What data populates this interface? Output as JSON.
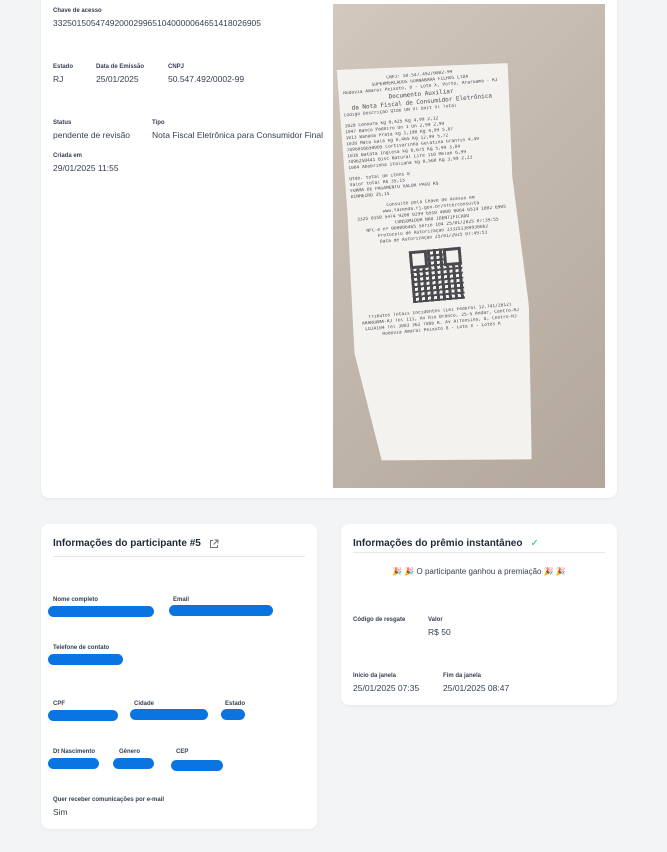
{
  "nota": {
    "chave_label": "Chave de acesso",
    "chave_value": "33250150547492000299651040000064651418026905",
    "estado_label": "Estado",
    "estado_value": "RJ",
    "data_emissao_label": "Data de Emissão",
    "data_emissao_value": "25/01/2025",
    "cnpj_label": "CNPJ",
    "cnpj_value": "50.547.492/0002-99",
    "status_label": "Status",
    "status_value": "pendente de revisão",
    "tipo_label": "Tipo",
    "tipo_value": "Nota Fiscal Eletrônica para Consumidor Final",
    "criada_label": "Criada em",
    "criada_value": "29/01/2025 11:55"
  },
  "receipt": {
    "lines": [
      "CNPJ: 50.547.492/0002-99",
      "SUPERMERCADOS GUANABARA FILHOS LTDA",
      "Rodovia Amaral Peixoto, 8 - Lote X, Porto, Araruama - RJ",
      "Documento Auxiliar",
      "da Nota Fiscal de Consumidor Eletrônica",
      "Código  Descrição   Qtde UN  Vl Unit  Vl Total",
      "1020    Cenoura kg        0,425 Kg   4,99    2,12",
      "1047    Banco Padeiro Un      1 Un   2,99    2,99",
      "1013    Banana Prata kg   1,190 Kg   4,99    5,87",
      "1038    Maca Gala kg      0,465 Kg  12,99    5,72",
      "7896016650005  Cortivarinha Gelatina Granfin  4,49",
      "1016    Batata Inglesa kg 0,675 Kg   5,99    3,84",
      "7896258441 Bisc Natural Life 110 Melan   6,99",
      "1004    Abobrinha Italiana kg 0,560 Kg 3,99  2,23",
      "Qtde. total de itens                8",
      "Valor total R$                  35,15",
      "FORMA DE PAGAMENTO          VALOR PAGO R$",
      "DINHEIRO                         35,15",
      "Consulte pela Chave de Acesso em",
      "www.fazenda.rj.gov.br/nfce/consulta",
      "3325 0150 5474 9200 0299 6510 4000 0064 6514 1802 6905",
      "CONSUMIDOR NÃO IDENTIFICADO",
      "NFC-e nº 000006465 Série 104 25/01/2025 07:39:55",
      "Protocolo de Autorização 333251384930862",
      "Data de Autorização 25/01/2025 07:49:53",
      "Tributos Totais Incidentes (Lei Federal 12.741/2012)",
      "ARARUAMA-RJ Tel 111, Av Rio Branco, 25-5 Andar, Centro-RJ",
      "LOJA104 Tel 3083 362 7866 R. Av Alfonsino, 8, Centro-RJ",
      "Rodovia Amaral Peixoto 8 - Lote X - Lotes K"
    ]
  },
  "participant": {
    "title": "Informações do participante #5",
    "nome_label": "Nome completo",
    "email_label": "Email",
    "telefone_label": "Telefone de contato",
    "cpf_label": "CPF",
    "cidade_label": "Cidade",
    "estado_label": "Estado",
    "nascimento_label": "Dt Nascimento",
    "genero_label": "Gênero",
    "cep_label": "CEP",
    "comunicacoes_label": "Quer receber comunicações por e-mail",
    "comunicacoes_value": "Sim"
  },
  "prize": {
    "title": "Informações do prêmio instantâneo",
    "message": "🎉 🎉 O participante ganhou a premiação 🎉 🎉",
    "codigo_label": "Código de resgate",
    "valor_label": "Valor",
    "valor_value": "R$ 50",
    "inicio_label": "Início da janela",
    "inicio_value": "25/01/2025 07:35",
    "fim_label": "Fim da janela",
    "fim_value": "25/01/2025 08:47"
  },
  "colors": {
    "background": "#f3f4f6",
    "card": "#ffffff",
    "redaction": "#0a74e0",
    "success": "#22c55e"
  }
}
